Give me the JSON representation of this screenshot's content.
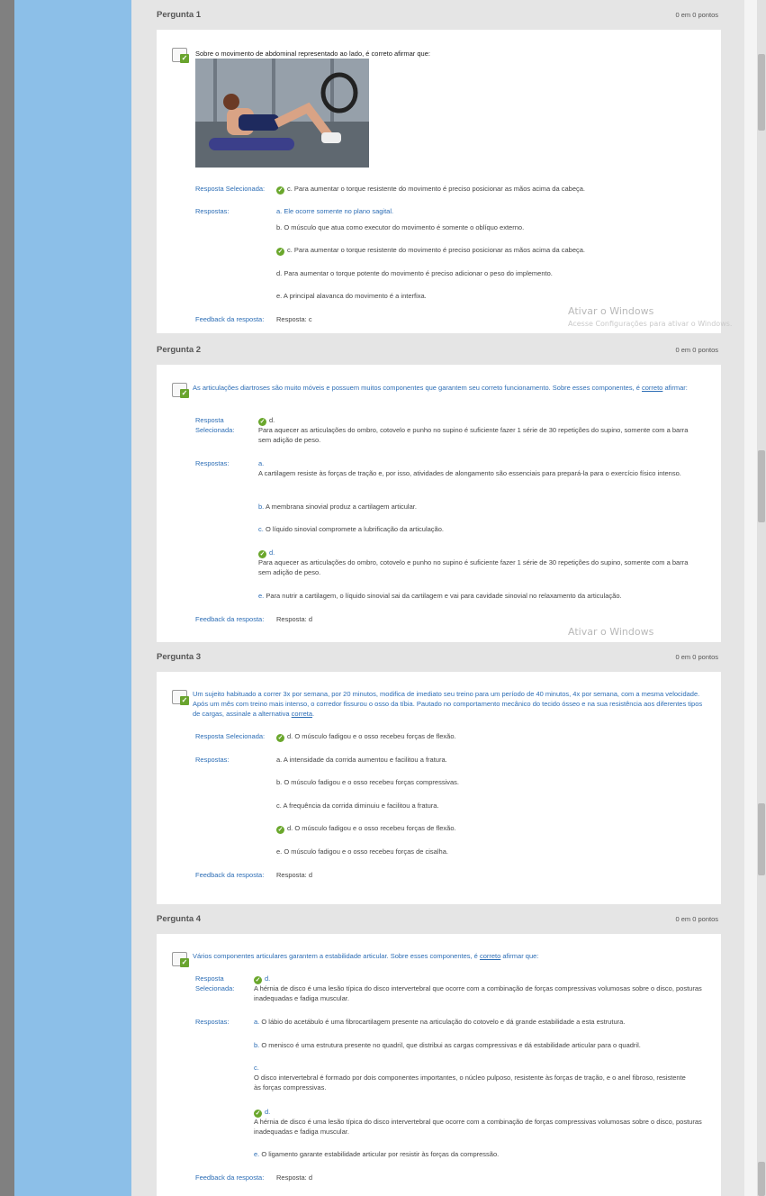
{
  "questions": [
    {
      "title": "Pergunta 1",
      "points": "0 em 0 pontos",
      "text": "Sobre o movimento de abdominal representado ao lado, é correto afirmar que:",
      "selected_label": "Resposta Selecionada:",
      "selected": "c. Para aumentar o torque resistente do movimento é preciso posicionar as mãos acima da cabeça.",
      "answers_label": "Respostas:",
      "answers": [
        "a. Ele ocorre somente no plano sagital.",
        "b. O músculo que atua como executor do movimento é somente o oblíquo externo.",
        "c. Para aumentar o torque resistente do movimento é preciso posicionar as mãos acima da cabeça.",
        "d. Para aumentar o torque potente do movimento é preciso adicionar o peso do implemento.",
        "e. A principal alavanca do movimento é a interfixa."
      ],
      "feedback_label": "Feedback da resposta:",
      "feedback": "Resposta: c"
    },
    {
      "title": "Pergunta 2",
      "points": "0 em 0 pontos",
      "text_before": "As articulações diartroses são muito móveis e possuem muitos componentes que garantem seu correto funcionamento. Sobre esses componentes, é ",
      "text_und": "correto",
      "text_after": " afirmar:",
      "selected_label_1": "Resposta",
      "selected_label_2": "Selecionada:",
      "selected_letter": "d.",
      "selected": "Para aquecer as articulações do ombro, cotovelo e punho no supino é suficiente fazer 1 série de 30 repetições do supino, somente com a barra sem adição de peso.",
      "answers_label": "Respostas:",
      "a_letter": "a.",
      "a_text": "A cartilagem resiste às forças de tração e, por isso, atividades de alongamento são essenciais para prepará-la para o exercício físico intenso.",
      "b_letter": "b.",
      "b_text": "A membrana sinovial produz a cartilagem articular.",
      "c_letter": "c.",
      "c_text": "O líquido sinovial compromete a lubrificação da articulação.",
      "d_letter": "d.",
      "d_text": "Para aquecer as articulações do ombro, cotovelo e punho no supino é suficiente fazer 1 série de 30 repetições do supino, somente com a barra sem adição de peso.",
      "e_letter": "e.",
      "e_text": "Para nutrir a cartilagem, o líquido sinovial sai da cartilagem e vai para cavidade sinovial no relaxamento da articulação.",
      "feedback_label": "Feedback da resposta:",
      "feedback": "Resposta: d"
    },
    {
      "title": "Pergunta 3",
      "points": "0 em 0 pontos",
      "text_before": "Um sujeito habituado a correr 3x por semana, por 20 minutos, modifica de imediato seu treino para um período de 40 minutos, 4x por semana, com a mesma velocidade. Após um mês com treino mais intenso, o corredor fissurou o osso da tíbia. Pautado no comportamento mecânico do tecido ósseo e na sua resistência aos diferentes tipos de cargas, assinale a alternativa ",
      "text_und": "correta",
      "text_after": ".",
      "selected_label": "Resposta Selecionada:",
      "selected": "d. O músculo fadigou e o osso recebeu forças de flexão.",
      "answers_label": "Respostas:",
      "answers": [
        "a. A intensidade da corrida aumentou e facilitou a fratura.",
        "b. O músculo fadigou e o osso recebeu forças compressivas.",
        "c. A frequência da corrida diminuiu e facilitou a fratura.",
        "d. O músculo fadigou e o osso recebeu forças de flexão.",
        "e. O músculo fadigou e o osso recebeu forças de cisalha."
      ],
      "feedback_label": "Feedback da resposta:",
      "feedback": "Resposta: d"
    },
    {
      "title": "Pergunta 4",
      "points": "0 em 0 pontos",
      "text_before": "Vários componentes articulares garantem a estabilidade articular. Sobre esses componentes, é ",
      "text_und": "correto",
      "text_after": " afirmar que:",
      "selected_label_1": "Resposta",
      "selected_label_2": "Selecionada:",
      "selected_letter": "d.",
      "selected": "A hérnia de disco é uma lesão típica do disco intervertebral que ocorre com a combinação de forças compressivas volumosas sobre o disco, posturas inadequadas e fadiga muscular.",
      "answers_label": "Respostas:",
      "a_letter": "a.",
      "a_text": "O lábio do acetábulo é uma fibrocartilagem presente na articulação do cotovelo e dá grande estabilidade a esta estrutura.",
      "b_letter": "b.",
      "b_text": "O menisco é uma estrutura presente no quadril, que distribui as cargas compressivas e dá estabilidade articular para o quadril.",
      "c_letter": "c.",
      "c_text": "O disco intervertebral é formado por dois componentes importantes, o núcleo pulposo, resistente às forças de tração, e o anel fibroso, resistente às forças compressivas.",
      "d_letter": "d.",
      "d_text": "A hérnia de disco é uma lesão típica do disco intervertebral que ocorre com a combinação de forças compressivas volumosas sobre o disco, posturas inadequadas e fadiga muscular.",
      "e_letter": "e.",
      "e_text": "O ligamento garante estabilidade articular por resistir às forças da compressão.",
      "feedback_label": "Feedback da resposta:",
      "feedback": "Resposta: d"
    }
  ],
  "watermark": {
    "title": "Ativar o Windows",
    "subtitle": "Acesse Configurações para ativar o Windows."
  },
  "icons": {
    "check": "check-icon",
    "question": "question-status-icon"
  },
  "colors": {
    "accent_blue": "#2c6db5",
    "check_green": "#6aa72c",
    "side_blue": "#8cbfe8"
  }
}
